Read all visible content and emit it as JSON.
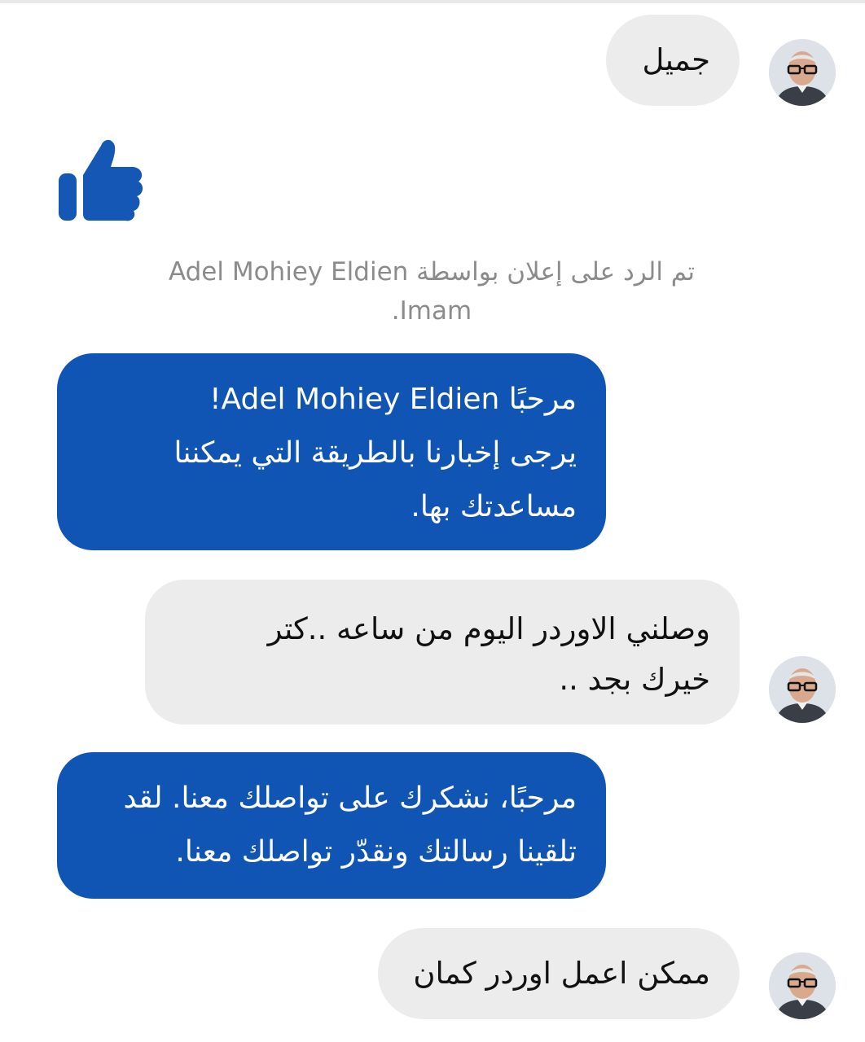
{
  "colors": {
    "outgoing_bubble": "#1155b4",
    "incoming_bubble": "#ececec",
    "like_icon": "#1557b5",
    "note_text": "#8b8b8b"
  },
  "messages": [
    {
      "direction": "incoming",
      "text": "جميل"
    },
    {
      "direction": "outgoing",
      "type": "like",
      "icon": "thumbs-up-icon"
    },
    {
      "direction": "system",
      "text": "تم الرد على إعلان بواسطة Adel Mohiey Eldien Imam."
    },
    {
      "direction": "outgoing",
      "lines": [
        "مرحبًا Adel Mohiey Eldien!",
        "يرجى إخبارنا بالطريقة التي يمكننا",
        "مساعدتك بها."
      ]
    },
    {
      "direction": "incoming",
      "lines": [
        "وصلني الاوردر اليوم من ساعه ..كتر",
        "خيرك بجد .."
      ]
    },
    {
      "direction": "outgoing",
      "lines": [
        "مرحبًا، نشكرك على تواصلك معنا. لقد",
        "تلقينا رسالتك ونقدّر تواصلك معنا."
      ]
    },
    {
      "direction": "incoming",
      "text": "ممكن اعمل اوردر كمان"
    }
  ]
}
